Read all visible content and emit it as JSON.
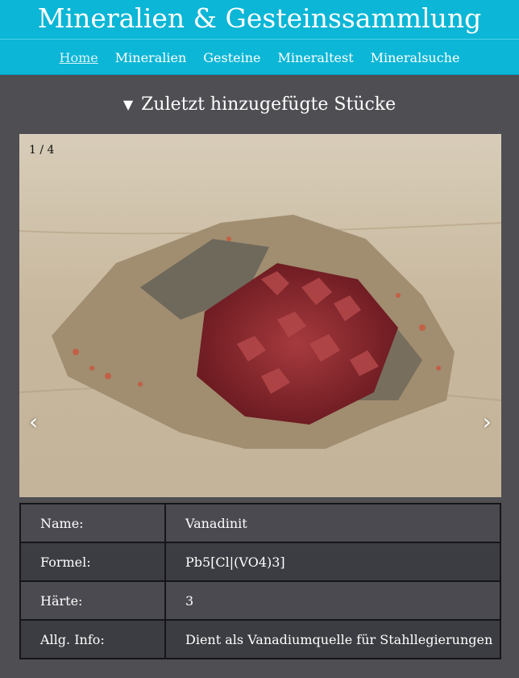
{
  "header": {
    "title": "Mineralien & Gesteinssammlung",
    "nav": [
      "Home",
      "Mineralien",
      "Gesteine",
      "Mineraltest",
      "Mineralsuche"
    ]
  },
  "section": {
    "heading": "Zuletzt hinzugefügte Stücke"
  },
  "slider": {
    "counter": "1 / 4",
    "prev": "‹",
    "next": "›"
  },
  "details": [
    {
      "label": "Name:",
      "value": "Vanadinit"
    },
    {
      "label": "Formel:",
      "value": "Pb5[Cl|(VO4)3]"
    },
    {
      "label": "Härte:",
      "value": "3"
    },
    {
      "label": "Allg. Info:",
      "value": "Dient als Vanadiumquelle für Stahllegierungen"
    }
  ]
}
